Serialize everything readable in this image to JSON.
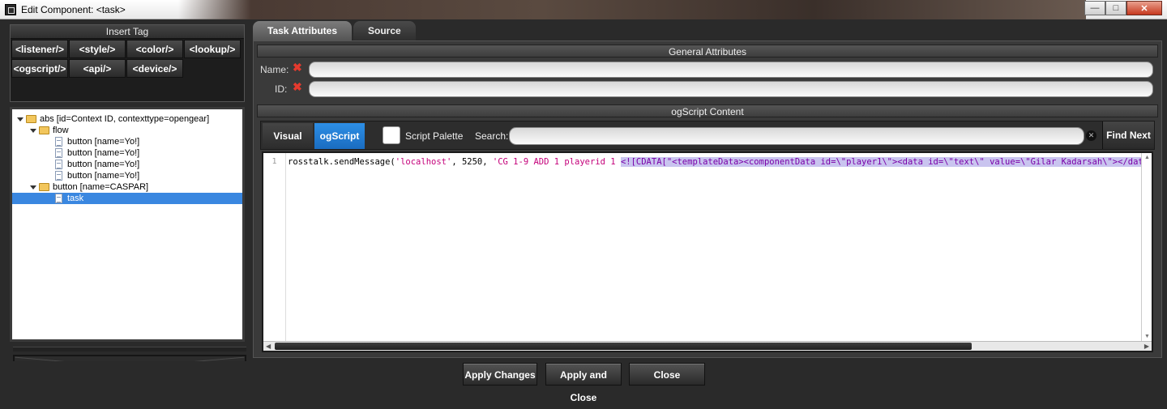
{
  "window": {
    "title": "Edit Component: <task>"
  },
  "insert_tag": {
    "header": "Insert Tag",
    "tags": [
      "<listener/>",
      "<style/>",
      "<color/>",
      "<lookup/>",
      "<ogscript/>",
      "<api/>",
      "<device/>"
    ]
  },
  "tree": {
    "items": [
      {
        "label": "abs [id=Context ID, contexttype=opengear]",
        "type": "folder",
        "level": 0,
        "expanded": true
      },
      {
        "label": "flow",
        "type": "folder",
        "level": 1,
        "expanded": true
      },
      {
        "label": "button [name=Yo!]",
        "type": "doc",
        "level": 2
      },
      {
        "label": "button [name=Yo!]",
        "type": "doc",
        "level": 2
      },
      {
        "label": "button [name=Yo!]",
        "type": "doc",
        "level": 2
      },
      {
        "label": "button [name=Yo!]",
        "type": "doc",
        "level": 2
      },
      {
        "label": "button [name=CASPAR]",
        "type": "folder",
        "level": 1,
        "expanded": true
      },
      {
        "label": "task",
        "type": "doc",
        "level": 2,
        "selected": true
      }
    ]
  },
  "tabs": [
    {
      "label": "Task Attributes",
      "active": true
    },
    {
      "label": "Source",
      "active": false
    }
  ],
  "general": {
    "header": "General Attributes",
    "name_label": "Name:",
    "id_label": "ID:",
    "name_value": "",
    "id_value": ""
  },
  "ogscript": {
    "header": "ogScript Content",
    "visual_label": "Visual",
    "ogscript_label": "ogScript",
    "palette_label": "Script Palette",
    "search_label": "Search:",
    "search_value": "",
    "find_next_label": "Find Next"
  },
  "editor": {
    "line_number": "1",
    "code_plain": "rosstalk.sendMessage(",
    "code_str1": "'localhost'",
    "code_mid": ", 5250, ",
    "code_str2": "'CG 1-9 ADD 1 playerid 1 ",
    "code_highlight": "<![CDATA[\"<templateData><componentData id=\\\"player1\\\"><data id=\\\"text\\\" value=\\\"Gilar Kadarsah\\\"></data></componentData></templateData>\"]]>'"
  },
  "actions": {
    "apply_changes": "Apply Changes",
    "apply_close": "Apply and Close",
    "close": "Close"
  },
  "colors": {
    "accent_blue": "#1a6cc0",
    "selection": "#3a87e0",
    "error_x": "#e53a2e",
    "string": "#c4007a"
  }
}
